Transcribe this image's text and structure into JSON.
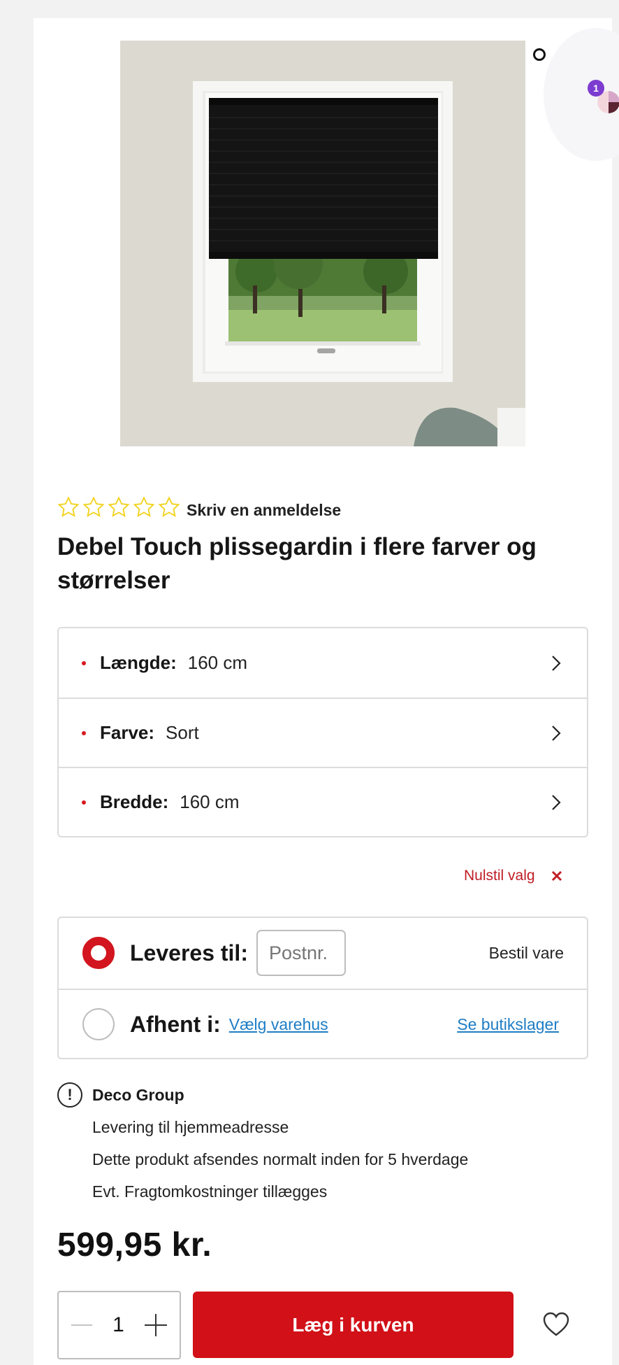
{
  "review": {
    "link_text": "Skriv en anmeldelse",
    "rating": 0,
    "max": 5
  },
  "product": {
    "title": "Debel Touch plissegardin i flere farver og størrelser"
  },
  "options": [
    {
      "label": "Længde:",
      "value": "160 cm"
    },
    {
      "label": "Farve:",
      "value": "Sort"
    },
    {
      "label": "Bredde:",
      "value": "160 cm"
    }
  ],
  "reset": {
    "label": "Nulstil valg"
  },
  "delivery": {
    "ship": {
      "label": "Leveres til:",
      "placeholder": "Postnr.",
      "action": "Bestil vare",
      "selected": true
    },
    "pickup": {
      "label": "Afhent i:",
      "choose_store": "Vælg varehus",
      "stock_link": "Se butikslager",
      "selected": false
    }
  },
  "vendor": {
    "name": "Deco Group",
    "lines": [
      "Levering til hjemmeadresse",
      "Dette produkt afsendes normalt inden for 5 hverdage",
      "Evt. Fragtomkostninger tillægges"
    ]
  },
  "price": {
    "text": "599,95 kr."
  },
  "purchase": {
    "quantity": "1",
    "add_to_cart": "Læg i kurven"
  },
  "notification": {
    "badge_count": "1"
  },
  "colors": {
    "accent_red": "#d11017",
    "link_blue": "#1f7dc4",
    "star_yellow": "#f2d21b",
    "badge_purple": "#7d3cd0"
  },
  "icons": [
    "star-icon",
    "chevron-right-icon",
    "close-icon",
    "info-icon",
    "minus-icon",
    "plus-icon",
    "heart-icon"
  ]
}
